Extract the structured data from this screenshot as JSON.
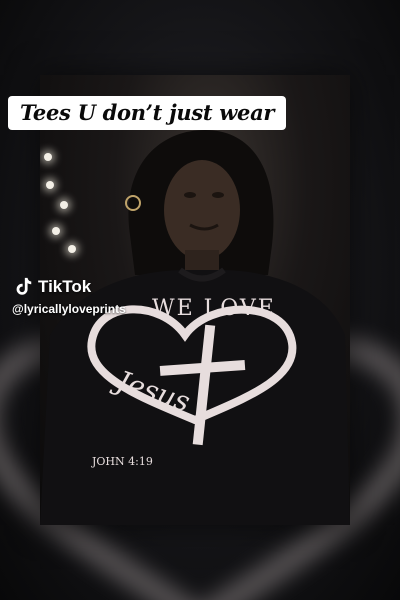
{
  "caption": {
    "text": "Tees U don’t just wear"
  },
  "watermark": {
    "brand": "TikTok",
    "handle": "@lyricallyloveprints",
    "logo_icon": "tiktok-logo-icon"
  },
  "shirt_print": {
    "top_text": "WE LOVE",
    "script_text": "Jesus",
    "verse": "JOHN 4:19",
    "heart_icon": "heart-outline-icon",
    "cross_icon": "cross-icon"
  },
  "colors": {
    "caption_bg": "#ffffff",
    "caption_text": "#0a0a0a",
    "print": "#e7dddd",
    "background": "#0c0c0e"
  }
}
